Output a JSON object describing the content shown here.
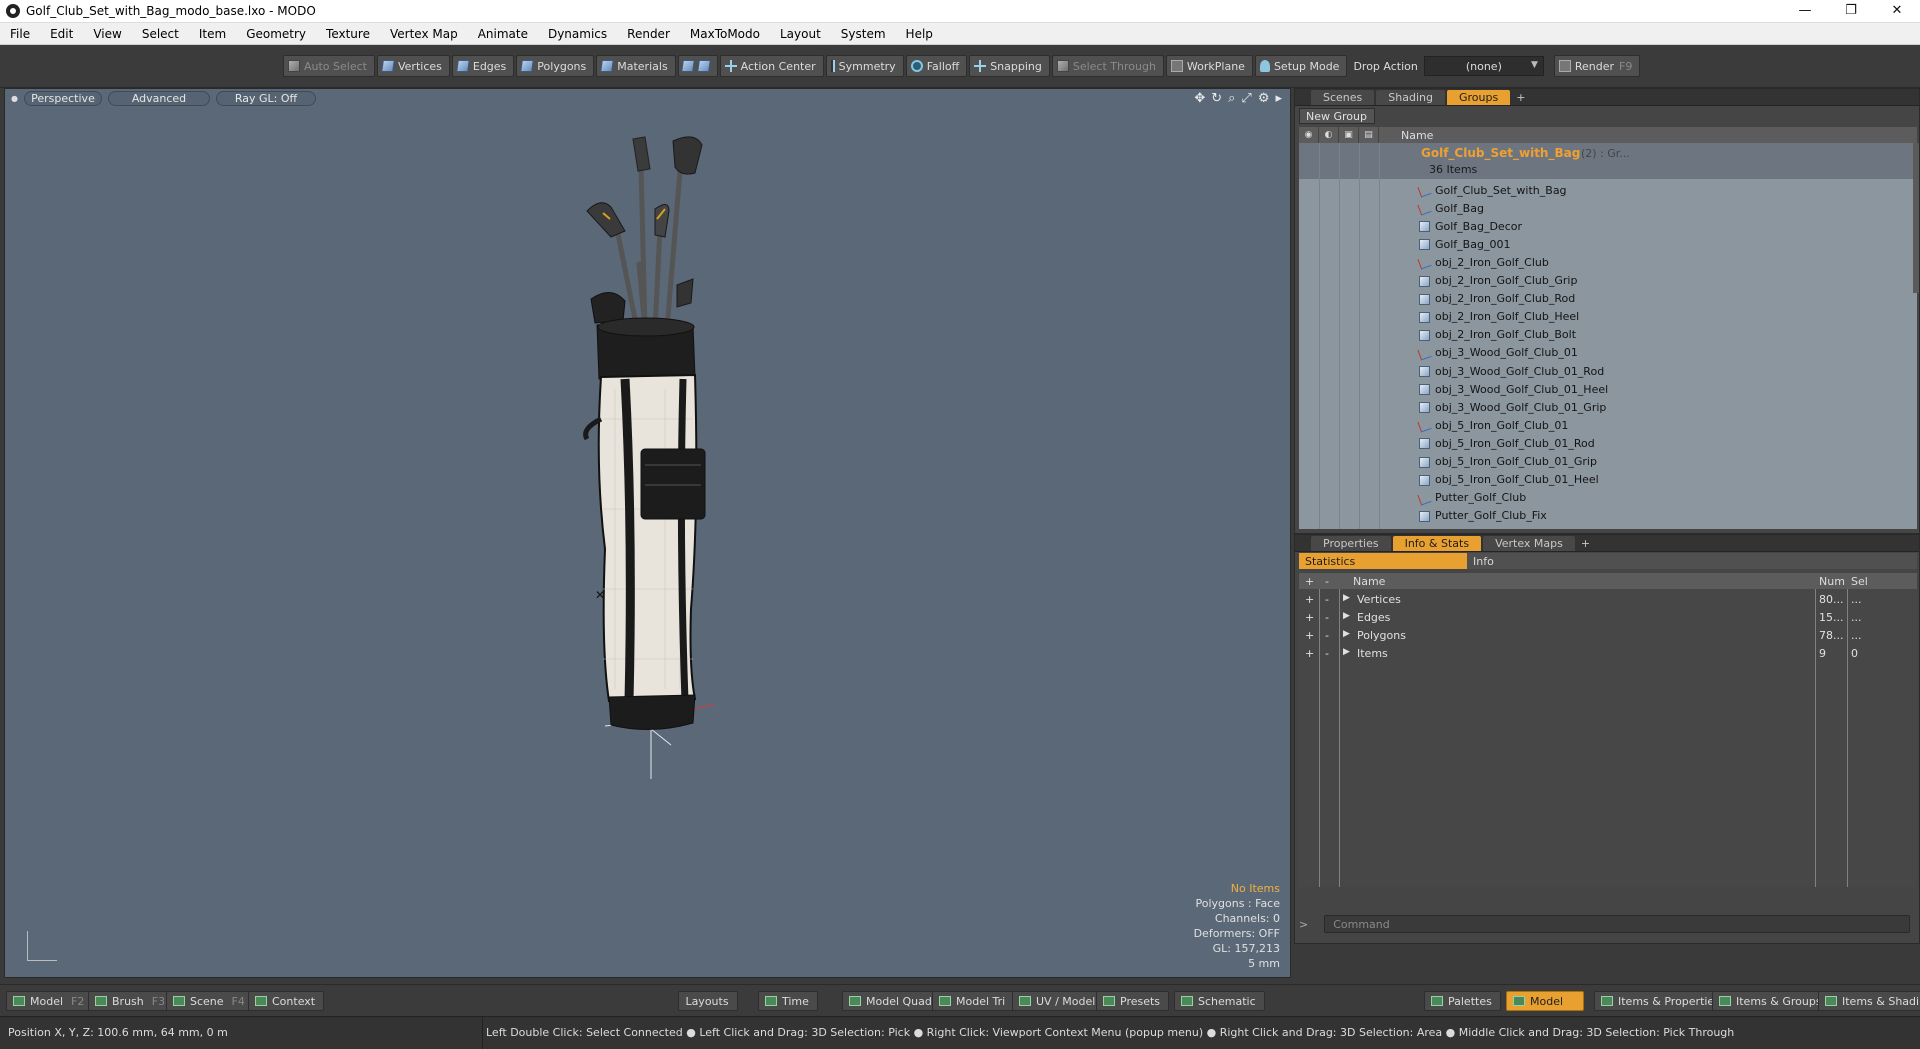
{
  "window": {
    "title": "Golf_Club_Set_with_Bag_modo_base.lxo - MODO",
    "controls": [
      "—",
      "❐",
      "✕"
    ]
  },
  "menu": [
    "File",
    "Edit",
    "View",
    "Select",
    "Item",
    "Geometry",
    "Texture",
    "Vertex Map",
    "Animate",
    "Dynamics",
    "Render",
    "MaxToModo",
    "Layout",
    "System",
    "Help"
  ],
  "toolbar": {
    "auto_select": "Auto Select",
    "vertices": "Vertices",
    "edges": "Edges",
    "polygons": "Polygons",
    "materials": "Materials",
    "action_center": "Action Center",
    "symmetry": "Symmetry",
    "falloff": "Falloff",
    "snapping": "Snapping",
    "select_through": "Select Through",
    "workplane": "WorkPlane",
    "setup_mode": "Setup Mode",
    "drop_action_label": "Drop Action",
    "drop_action_value": "(none)",
    "render": "Render",
    "render_key": "F9"
  },
  "viewport": {
    "tabs": [
      "Perspective",
      "Advanced",
      "Ray GL: Off"
    ],
    "stats": {
      "items": "No Items",
      "polygons": "Polygons : Face",
      "channels": "Channels: 0",
      "deformers": "Deformers: OFF",
      "gl": "GL: 157,213",
      "scale": "5 mm"
    },
    "colors": {
      "background": "#5a6878",
      "bag_white": "#e8e4dc",
      "bag_black": "#1c1c1c"
    }
  },
  "groups_panel": {
    "tabs": [
      "Scenes",
      "Shading",
      "Groups"
    ],
    "active_tab": "Groups",
    "new_group": "New Group",
    "column_name": "Name",
    "root": {
      "name": "Golf_Club_Set_with_Bag",
      "extra": "(2) : Gr...",
      "count": "36 Items"
    },
    "items": [
      {
        "label": "Golf_Club_Set_with_Bag",
        "icon": "locator-icon"
      },
      {
        "label": "Golf_Bag",
        "icon": "locator-icon"
      },
      {
        "label": "Golf_Bag_Decor",
        "icon": "mesh-icon"
      },
      {
        "label": "Golf_Bag_001",
        "icon": "mesh-icon"
      },
      {
        "label": "obj_2_Iron_Golf_Club",
        "icon": "locator-icon"
      },
      {
        "label": "obj_2_Iron_Golf_Club_Grip",
        "icon": "mesh-icon"
      },
      {
        "label": "obj_2_Iron_Golf_Club_Rod",
        "icon": "mesh-icon"
      },
      {
        "label": "obj_2_Iron_Golf_Club_Heel",
        "icon": "mesh-icon"
      },
      {
        "label": "obj_2_Iron_Golf_Club_Bolt",
        "icon": "mesh-icon"
      },
      {
        "label": "obj_3_Wood_Golf_Club_01",
        "icon": "locator-icon"
      },
      {
        "label": "obj_3_Wood_Golf_Club_01_Rod",
        "icon": "mesh-icon"
      },
      {
        "label": "obj_3_Wood_Golf_Club_01_Heel",
        "icon": "mesh-icon"
      },
      {
        "label": "obj_3_Wood_Golf_Club_01_Grip",
        "icon": "mesh-icon"
      },
      {
        "label": "obj_5_Iron_Golf_Club_01",
        "icon": "locator-icon"
      },
      {
        "label": "obj_5_Iron_Golf_Club_01_Rod",
        "icon": "mesh-icon"
      },
      {
        "label": "obj_5_Iron_Golf_Club_01_Grip",
        "icon": "mesh-icon"
      },
      {
        "label": "obj_5_Iron_Golf_Club_01_Heel",
        "icon": "mesh-icon"
      },
      {
        "label": "Putter_Golf_Club",
        "icon": "locator-icon"
      },
      {
        "label": "Putter_Golf_Club_Fix",
        "icon": "mesh-icon"
      }
    ]
  },
  "info_panel": {
    "tabs": [
      "Properties",
      "Info & Stats",
      "Vertex Maps"
    ],
    "active_tab": "Info & Stats",
    "sub_tabs": [
      "Statistics",
      "Info"
    ],
    "columns": {
      "name": "Name",
      "num": "Num",
      "sel": "Sel"
    },
    "rows": [
      {
        "name": "Vertices",
        "num": "80...",
        "sel": "..."
      },
      {
        "name": "Edges",
        "num": "15...",
        "sel": "..."
      },
      {
        "name": "Polygons",
        "num": "78...",
        "sel": "..."
      },
      {
        "name": "Items",
        "num": "9",
        "sel": "0"
      }
    ],
    "command_placeholder": "Command"
  },
  "bottombar": {
    "model": "Model",
    "model_key": "F2",
    "brush": "Brush",
    "brush_key": "F3",
    "scene": "Scene",
    "scene_key": "F4",
    "context": "Context",
    "layouts": "Layouts",
    "time": "Time",
    "model_quad": "Model Quad",
    "model_tri": "Model Tri",
    "uv_model": "UV / Model",
    "presets": "Presets",
    "schematic": "Schematic",
    "palettes": "Palettes",
    "model_active": "Model",
    "items_properties": "Items & Properties",
    "items_groups": "Items & Groups",
    "items_shading": "Items & Shading"
  },
  "status": {
    "position": "Position X, Y, Z:   100.6 mm, 64 mm, 0 m",
    "hint": "Left Double Click: Select Connected ● Left Click and Drag: 3D Selection: Pick ● Right Click: Viewport Context Menu (popup menu) ● Right Click and Drag: 3D Selection: Area ● Middle Click and Drag: 3D Selection: Pick Through"
  }
}
